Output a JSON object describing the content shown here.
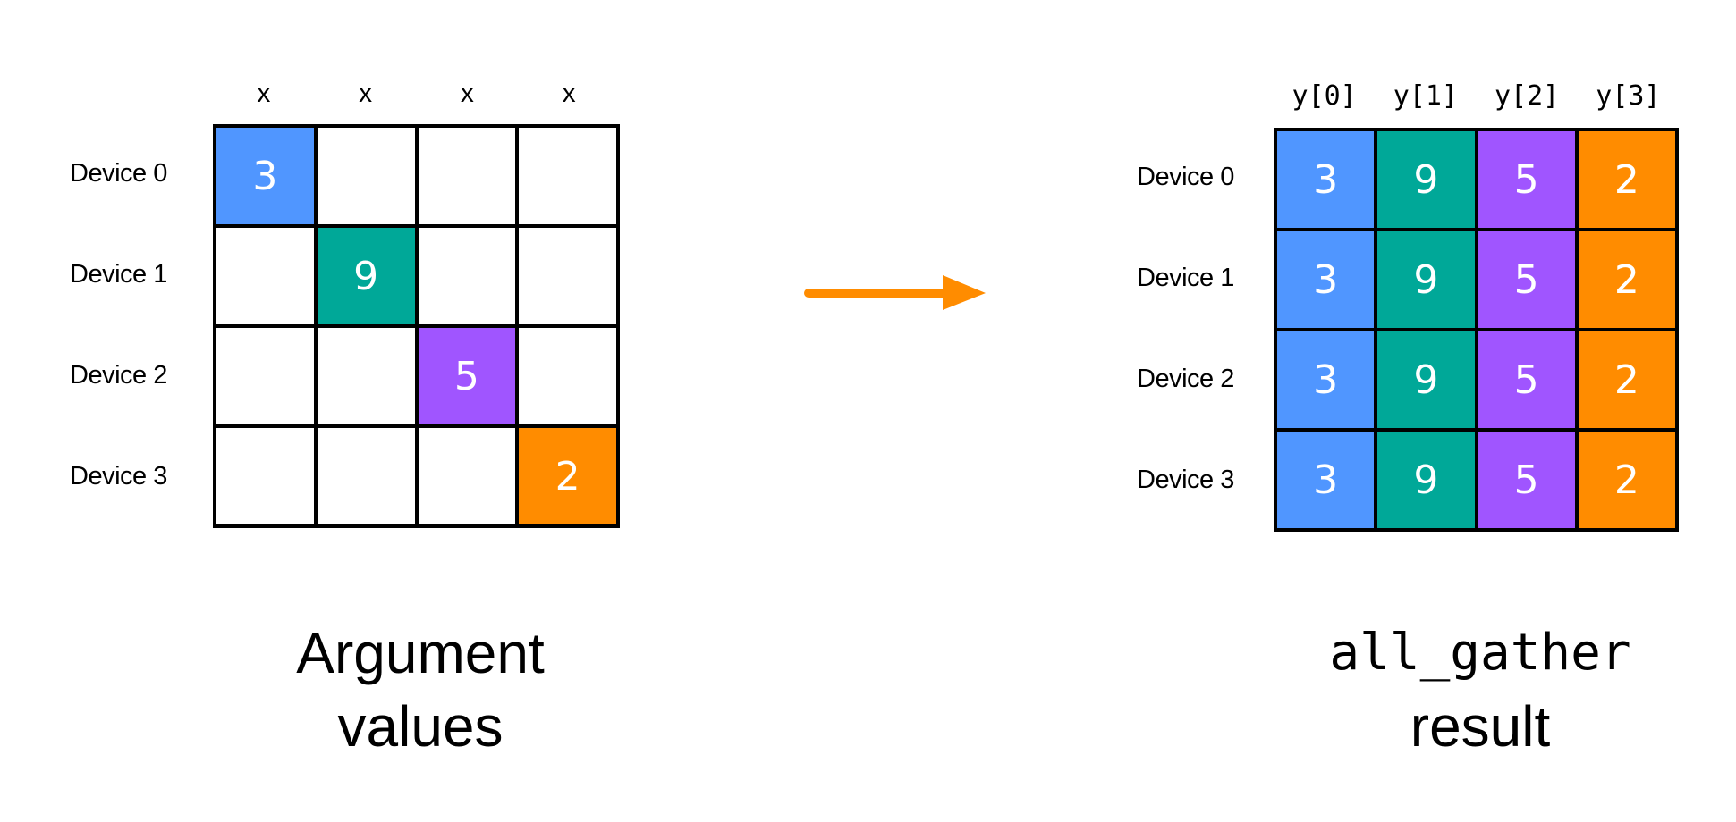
{
  "colors": {
    "blue": "#5096FF",
    "teal": "#00A898",
    "purple": "#A055FF",
    "orange": "#FF8C00",
    "arrow": "#FF8C00"
  },
  "left_panel": {
    "column_headers": [
      "x",
      "x",
      "x",
      "x"
    ],
    "row_labels": [
      "Device 0",
      "Device 1",
      "Device 2",
      "Device 3"
    ],
    "cells": [
      [
        {
          "value": "3",
          "color": "blue"
        },
        {
          "value": "",
          "color": ""
        },
        {
          "value": "",
          "color": ""
        },
        {
          "value": "",
          "color": ""
        }
      ],
      [
        {
          "value": "",
          "color": ""
        },
        {
          "value": "9",
          "color": "teal"
        },
        {
          "value": "",
          "color": ""
        },
        {
          "value": "",
          "color": ""
        }
      ],
      [
        {
          "value": "",
          "color": ""
        },
        {
          "value": "",
          "color": ""
        },
        {
          "value": "5",
          "color": "purple"
        },
        {
          "value": "",
          "color": ""
        }
      ],
      [
        {
          "value": "",
          "color": ""
        },
        {
          "value": "",
          "color": ""
        },
        {
          "value": "",
          "color": ""
        },
        {
          "value": "2",
          "color": "orange"
        }
      ]
    ],
    "caption_line1": "Argument",
    "caption_line2": "values"
  },
  "arrow": {
    "icon": "arrow-right-icon"
  },
  "right_panel": {
    "column_headers": [
      "y[0]",
      "y[1]",
      "y[2]",
      "y[3]"
    ],
    "row_labels": [
      "Device 0",
      "Device 1",
      "Device 2",
      "Device 3"
    ],
    "cells": [
      [
        {
          "value": "3",
          "color": "blue"
        },
        {
          "value": "9",
          "color": "teal"
        },
        {
          "value": "5",
          "color": "purple"
        },
        {
          "value": "2",
          "color": "orange"
        }
      ],
      [
        {
          "value": "3",
          "color": "blue"
        },
        {
          "value": "9",
          "color": "teal"
        },
        {
          "value": "5",
          "color": "purple"
        },
        {
          "value": "2",
          "color": "orange"
        }
      ],
      [
        {
          "value": "3",
          "color": "blue"
        },
        {
          "value": "9",
          "color": "teal"
        },
        {
          "value": "5",
          "color": "purple"
        },
        {
          "value": "2",
          "color": "orange"
        }
      ],
      [
        {
          "value": "3",
          "color": "blue"
        },
        {
          "value": "9",
          "color": "teal"
        },
        {
          "value": "5",
          "color": "purple"
        },
        {
          "value": "2",
          "color": "orange"
        }
      ]
    ],
    "caption_line1": "all_gather",
    "caption_line2": "result"
  }
}
